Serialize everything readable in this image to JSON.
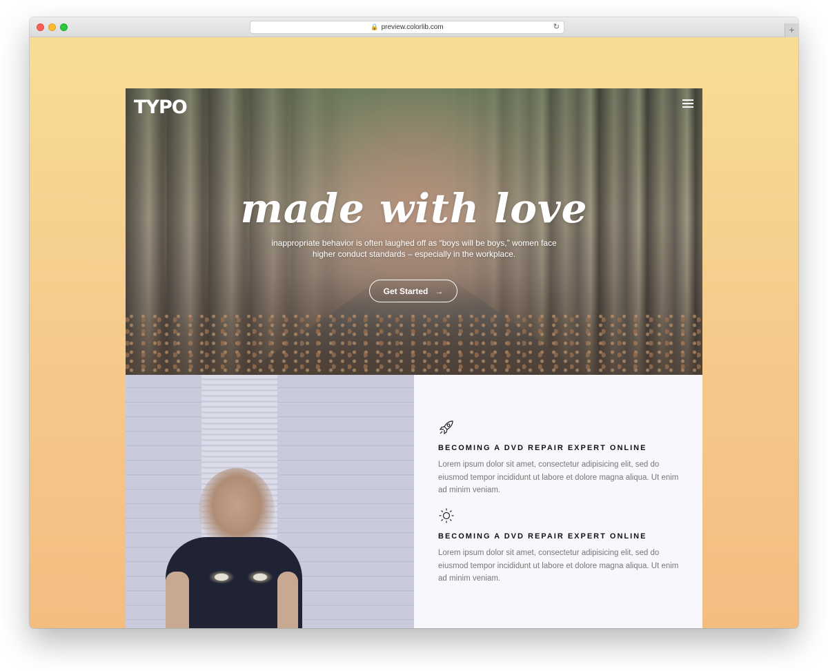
{
  "browser": {
    "url": "preview.colorlib.com",
    "new_tab_symbol": "+"
  },
  "hero": {
    "logo": "TYPO",
    "title": "made with love",
    "subtitle": "inappropriate behavior is often laughed off as “boys will be boys,” women face higher conduct standards – especially in the workplace.",
    "cta_label": "Get Started",
    "cta_arrow": "→"
  },
  "features": [
    {
      "icon": "rocket-icon",
      "heading": "BECOMING A DVD REPAIR EXPERT ONLINE",
      "text": "Lorem ipsum dolor sit amet, consectetur adipisicing elit, sed do eiusmod tempor incididunt ut labore et dolore magna aliqua. Ut enim ad minim veniam."
    },
    {
      "icon": "sun-icon",
      "heading": "BECOMING A DVD REPAIR EXPERT ONLINE",
      "text": "Lorem ipsum dolor sit amet, consectetur adipisicing elit, sed do eiusmod tempor incididunt ut labore et dolore magna aliqua. Ut enim ad minim veniam."
    }
  ],
  "colors": {
    "page_gradient_top": "#f8dd95",
    "page_gradient_bottom": "#f3bd80",
    "feature_panel_bg": "#f8f8fc"
  }
}
